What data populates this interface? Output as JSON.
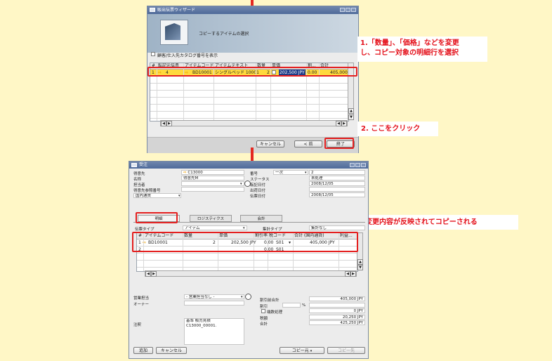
{
  "colors": {
    "background": "#fff7c6",
    "highlight": "#e41f1f",
    "selected_row": "#ffd93d",
    "link_arrow": "#f0a000",
    "titlebar": "#5670a0"
  },
  "wizard": {
    "title": "販出伝票ウィザード",
    "subtitle": "コピーするアイテムの選択",
    "checkbox_label": "顧客/仕入先カタログ番号を表示",
    "columns": [
      "#",
      "転記元伝票",
      "アイテムコード",
      "アイテムテキスト",
      "数量",
      "単価",
      "割...",
      "合計"
    ],
    "row": {
      "num": "1",
      "source": "4",
      "item_code": "BD10001",
      "item_text": "シングルベッド 10001",
      "qty": "2",
      "price": "202,500 JPY",
      "disc": "0.00",
      "total": "405,000 JF"
    },
    "buttons": {
      "cancel": "キャンセル",
      "back": "< 前",
      "finish": "終了"
    },
    "scroll_left": "◀",
    "scroll_right": "▶",
    "scroll_up": "▲",
    "scroll_down": "▼"
  },
  "callouts": {
    "c1_line1": "1.「数量」、「価格」などを変更",
    "c1_line2": "し、コピー対象の明細行を選択",
    "c2": "2. ここをクリック",
    "c3": "変更内容が反映されてコピーされる"
  },
  "order": {
    "title": "受注",
    "header_left": [
      {
        "label": "得意先",
        "value": "C13000"
      },
      {
        "label": "名称",
        "value": "得意先M"
      },
      {
        "label": "担当者",
        "value": ""
      },
      {
        "label": "得意先参照番号",
        "value": ""
      },
      {
        "label": "国内通貨",
        "value": ""
      }
    ],
    "header_right": [
      {
        "label": "番号",
        "value": "一次",
        "value2": "2"
      },
      {
        "label": "ステータス",
        "value": "未処理"
      },
      {
        "label": "転記日付",
        "value": "2008/12/05"
      },
      {
        "label": "出荷日付",
        "value": ""
      },
      {
        "label": "伝票日付",
        "value": "2008/12/05"
      }
    ],
    "tabs": [
      "明細",
      "ロジスティクス",
      "会計"
    ],
    "item_type_label": "伝票タイプ",
    "item_type_value": "アイテム",
    "summary_label": "集計タイプ",
    "summary_value": "集計なし",
    "columns": [
      "#",
      "アイテムコード",
      "数量",
      "単価",
      "割引率",
      "税コード",
      "合計 (国内通貨)",
      "利益..."
    ],
    "rows": [
      {
        "num": "1",
        "item_code": "BD10001",
        "qty": "2",
        "price": "202,500 JPY",
        "disc": "0.00",
        "tax": "S01",
        "total": "405,000 JPY"
      },
      {
        "num": "2",
        "item_code": "",
        "qty": "",
        "price": "",
        "disc": "0.00",
        "tax": "S01",
        "total": ""
      }
    ],
    "sales_emp_label": "営業担当",
    "sales_emp_value": "- 営業担当なし -",
    "owner_label": "オーナー",
    "remarks_label": "注釈",
    "remarks_value": "基準 販売見積\nC13000_00001.",
    "totals": [
      {
        "label": "割引前合計",
        "value": "405,000 JPY"
      },
      {
        "label": "割引",
        "value": "",
        "extra": "%"
      },
      {
        "label": "端数処理",
        "value": "0 JPY"
      },
      {
        "label": "税額",
        "value": "20,250 JPY"
      },
      {
        "label": "合計",
        "value": "425,250 JPY"
      }
    ],
    "buttons": {
      "add": "追加",
      "cancel": "キャンセル",
      "copy_from": "コピー元",
      "copy_to": "コピー先"
    }
  }
}
